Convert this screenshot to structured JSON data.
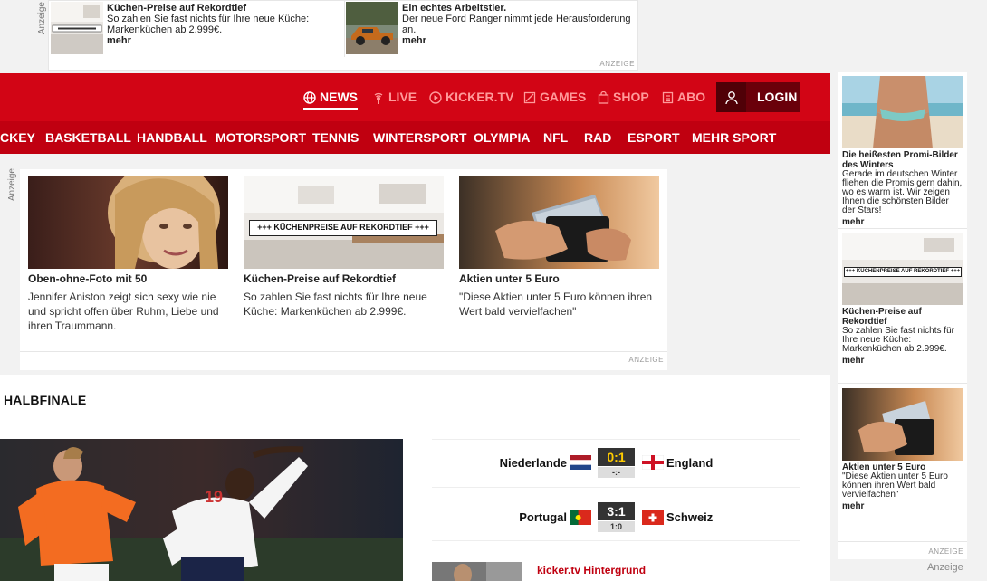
{
  "top_ad": {
    "label": "Anzeige",
    "footer": "ANZEIGE",
    "items": [
      {
        "title": "Küchen-Preise auf Rekordtief",
        "desc": "So zahlen Sie fast nichts für Ihre neue Küche: Markenküchen ab 2.999€.",
        "more": "mehr"
      },
      {
        "title": "Ein echtes Arbeitstier.",
        "desc": "Der neue Ford Ranger nimmt jede Herausforderung an.",
        "more": "mehr"
      }
    ]
  },
  "nav": {
    "main": [
      {
        "label": "NEWS",
        "icon": "globe-icon",
        "active": true
      },
      {
        "label": "LIVE",
        "icon": "live-icon",
        "active": false
      },
      {
        "label": "KICKER.TV",
        "icon": "play-icon",
        "active": false
      },
      {
        "label": "GAMES",
        "icon": "games-icon",
        "active": false
      },
      {
        "label": "SHOP",
        "icon": "bag-icon",
        "active": false
      },
      {
        "label": "ABO",
        "icon": "newspaper-icon",
        "active": false
      }
    ],
    "login": "LOGIN",
    "sports": [
      "CKEY",
      "BASKETBALL",
      "HANDBALL",
      "MOTORSPORT",
      "TENNIS",
      "WINTERSPORT",
      "OLYMPIA",
      "NFL",
      "RAD",
      "ESPORT",
      "MEHR SPORT"
    ],
    "colors": {
      "primary": "#d20515",
      "secondary": "#c00010",
      "login_bg": "#6a000a"
    }
  },
  "mid_ad": {
    "label": "Anzeige",
    "footer": "ANZEIGE",
    "cards": [
      {
        "title": "Oben-ohne-Foto mit 50",
        "desc": "Jennifer Aniston zeigt sich sexy wie nie und spricht offen über Ruhm, Liebe und ihren Traummann."
      },
      {
        "title": "Küchen-Preise auf Rekordtief",
        "desc": "So zahlen Sie fast nichts für Ihre neue Küche: Markenküchen ab 2.999€.",
        "banner": "+++ KÜCHENPREISE AUF REKORDTIEF +++"
      },
      {
        "title": "Aktien unter 5 Euro",
        "desc": "\"Diese Aktien unter 5 Euro können ihren Wert bald vervielfachen\""
      }
    ]
  },
  "section": {
    "title": "HALBFINALE",
    "matches": [
      {
        "home": "Niederlande",
        "away": "England",
        "score": "0:1",
        "half": "-:-"
      },
      {
        "home": "Portugal",
        "away": "Schweiz",
        "score": "3:1",
        "half": "1:0"
      }
    ],
    "kicker_link": "kicker.tv Hintergrund"
  },
  "sidebar": {
    "label": "Anzeige",
    "footer": "ANZEIGE",
    "items": [
      {
        "title": "Die heißesten Promi-Bilder des Winters",
        "desc": "Gerade im deutschen Winter fliehen die Promis gern dahin, wo es warm ist. Wir zeigen Ihnen die schönsten Bilder der Stars!",
        "more": "mehr"
      },
      {
        "title": "Küchen-Preise auf Rekordtief",
        "desc": "So zahlen Sie fast nichts für Ihre neue Küche: Markenküchen ab 2.999€.",
        "more": "mehr",
        "banner": "+++ KÜCHENPREISE AUF REKORDTIEF +++"
      },
      {
        "title": "Aktien unter 5 Euro",
        "desc": "\"Diese Aktien unter 5 Euro können ihren Wert bald vervielfachen\"",
        "more": "mehr"
      }
    ]
  }
}
